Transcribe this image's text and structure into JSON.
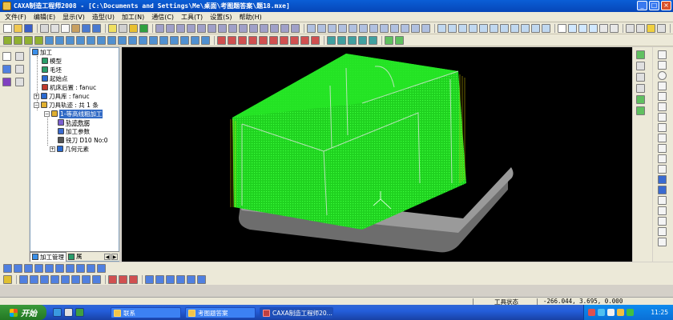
{
  "window": {
    "title": "CAXA制造工程师2008  - [C:\\Documents and Settings\\Me\\桌面\\考图题答案\\题18.mxe]",
    "minimize": "_",
    "maximize": "□",
    "close": "×"
  },
  "menu": {
    "items": [
      {
        "label": "文件(F)"
      },
      {
        "label": "编辑(E)"
      },
      {
        "label": "显示(V)"
      },
      {
        "label": "造型(U)"
      },
      {
        "label": "加工(N)"
      },
      {
        "label": "通信(C)"
      },
      {
        "label": "工具(T)"
      },
      {
        "label": "设置(S)"
      },
      {
        "label": "帮助(H)"
      }
    ]
  },
  "tree": {
    "items": [
      {
        "label": "加工",
        "icon": "machining-folder-icon",
        "color": "#3a8ee8"
      },
      {
        "label": "模型",
        "icon": "model-icon",
        "color": "#2a9d6a"
      },
      {
        "label": "毛坯",
        "icon": "blank-icon",
        "color": "#2a9d6a"
      },
      {
        "label": "起始点",
        "icon": "start-point-icon",
        "color": "#2a6ad0"
      },
      {
        "label": "机床后置 : fanuc",
        "icon": "machine-post-icon",
        "color": "#c0392b"
      },
      {
        "label": "刀具库 : fanuc",
        "icon": "tool-library-icon",
        "color": "#2a6ad0"
      },
      {
        "label": "刀具轨迹 : 共 1 条",
        "icon": "toolpath-folder-icon",
        "color": "#e0b030"
      },
      {
        "label": "1-等高线粗加工",
        "icon": "toolpath-icon",
        "color": "#e0b030"
      },
      {
        "label": "轨迹数据",
        "icon": "track-data-icon",
        "color": "#7a5fd0"
      },
      {
        "label": "加工参数",
        "icon": "params-icon",
        "color": "#3a6ad0"
      },
      {
        "label": "铣刀 D10 No:0",
        "icon": "mill-cutter-icon",
        "color": "#555555"
      },
      {
        "label": "几何元素",
        "icon": "geometry-icon",
        "color": "#2a6ad0"
      }
    ]
  },
  "tabs": [
    {
      "label": "加工管理"
    },
    {
      "label": "属"
    }
  ],
  "status": {
    "state": "工具状态",
    "coords": "-266.044, 3.695, 0.000"
  },
  "taskbar": {
    "start": "开始",
    "tasks": [
      {
        "label": "联系"
      },
      {
        "label": "考图题答案"
      },
      {
        "label": "CAXA制造工程师20..."
      }
    ],
    "clock": "11:25"
  },
  "viewport": {
    "background": "#000000",
    "toolpath_color": "#00ff00",
    "platform_color": "#8a8a8a"
  }
}
